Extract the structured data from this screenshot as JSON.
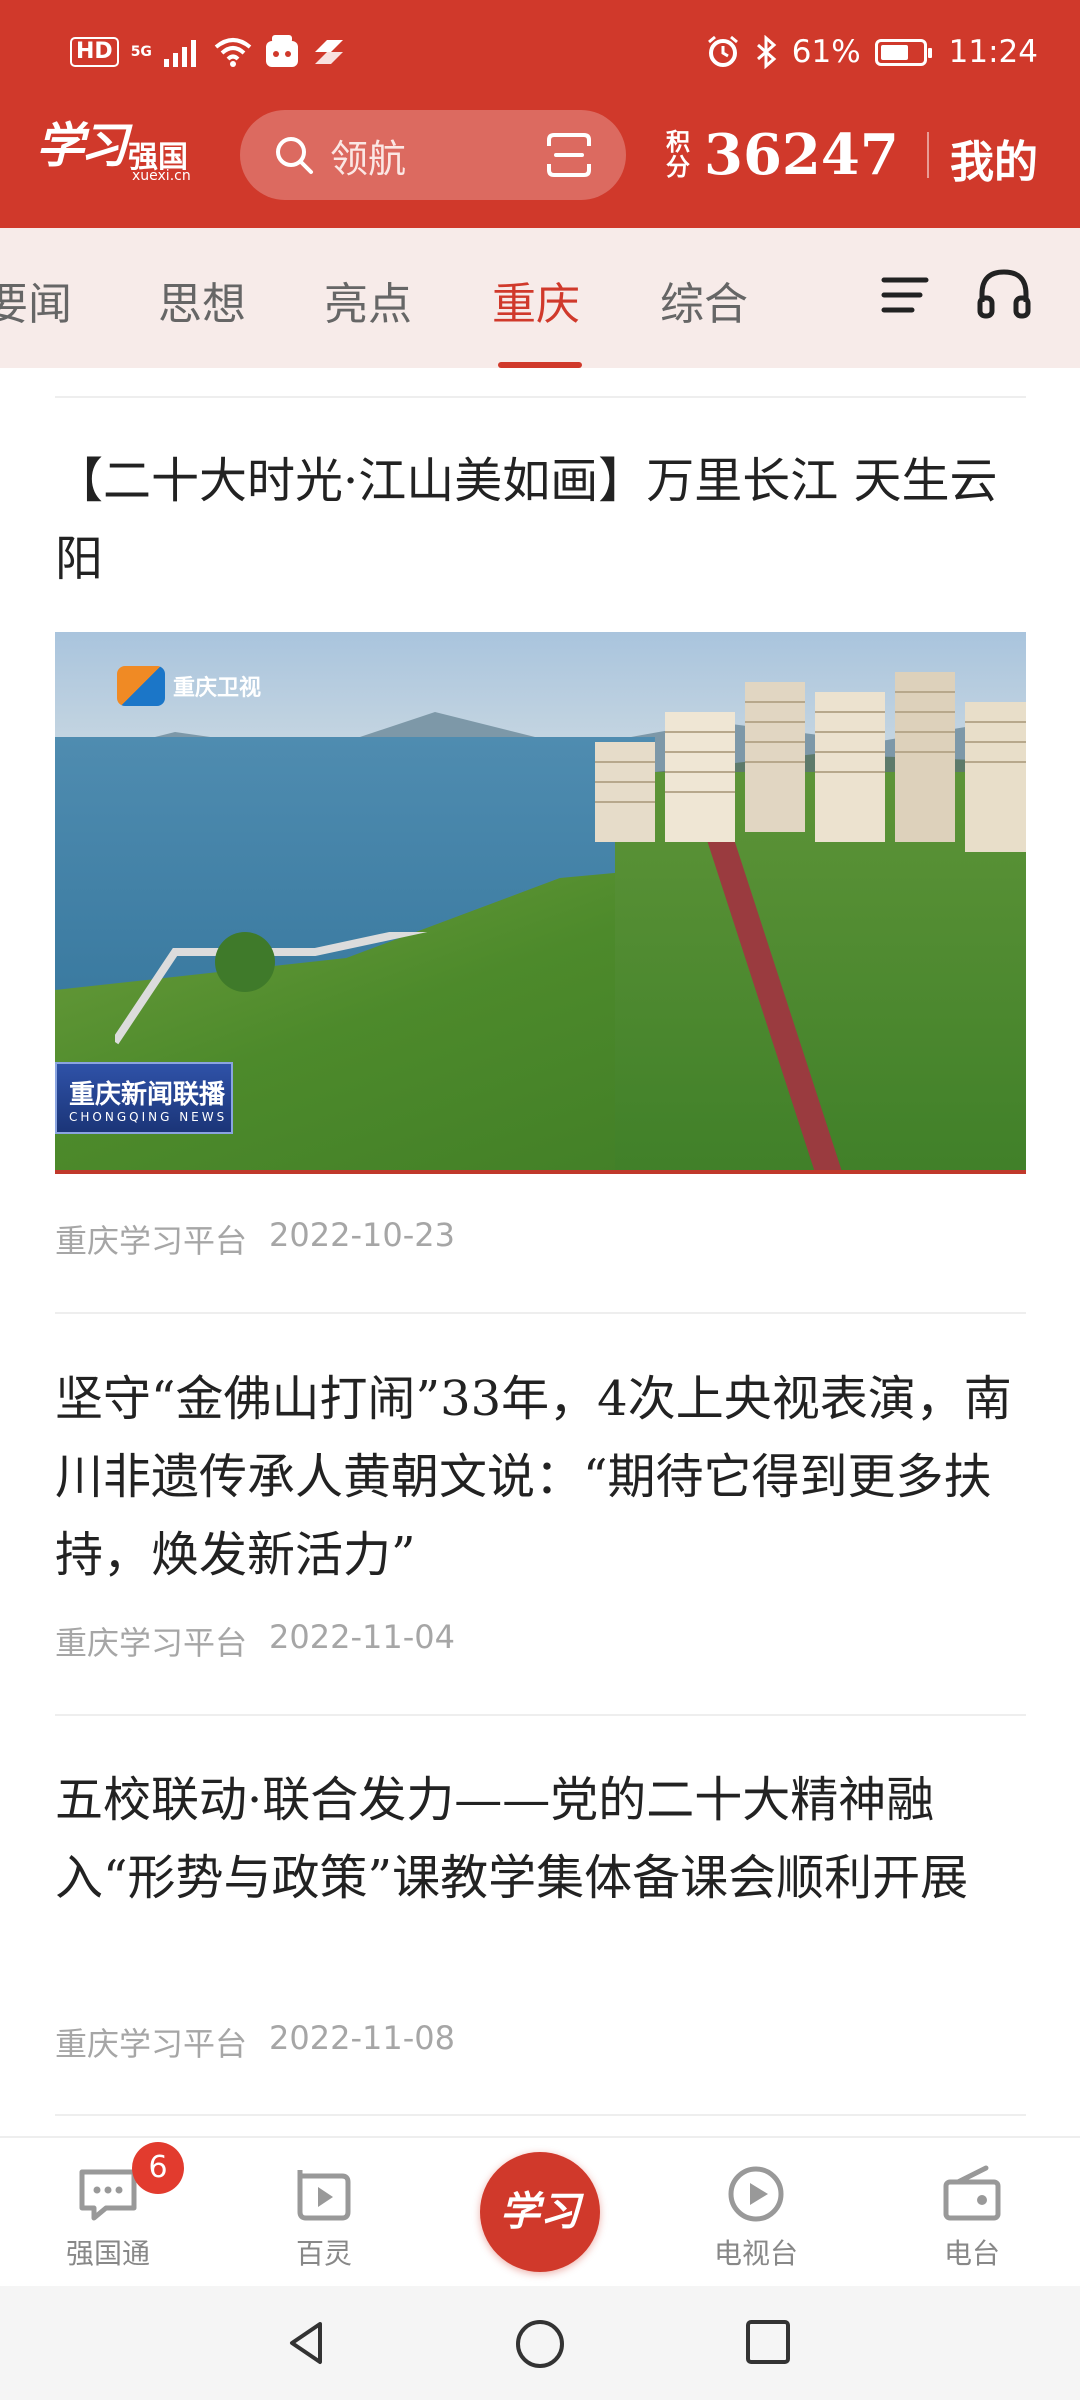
{
  "status_bar": {
    "hd": "HD",
    "network": "5G",
    "battery": "61%",
    "time": "11:24"
  },
  "header": {
    "logo_script": "学习",
    "logo_text": "强国",
    "logo_domain": "xuexi.cn",
    "search_placeholder": "领航",
    "points_label": "积分",
    "points_value": "36247",
    "my_label": "我的"
  },
  "tabs": [
    {
      "label": "要闻"
    },
    {
      "label": "思想"
    },
    {
      "label": "亮点"
    },
    {
      "label": "重庆",
      "active": true
    },
    {
      "label": "综合"
    }
  ],
  "feed": [
    {
      "title": "【二十大时光·江山美如画】万里长江 天生云阳",
      "has_video": true,
      "video_channel": "重庆卫视",
      "video_tag": "重庆新闻联播",
      "video_tag_en": "CHONGQING NEWS",
      "source": "重庆学习平台",
      "date": "2022-10-23"
    },
    {
      "title": "坚守“金佛山打闹”33年，4次上央视表演，南川非遗传承人黄朝文说：“期待它得到更多扶持，焕发新活力”",
      "source": "重庆学习平台",
      "date": "2022-11-04"
    },
    {
      "title": "五校联动·联合发力——党的二十大精神融入“形势与政策”课教学集体备课会顺利开展",
      "source": "重庆学习平台",
      "date": "2022-11-08"
    }
  ],
  "bottom_nav": {
    "items": [
      {
        "label": "强国通",
        "icon": "chat-icon"
      },
      {
        "label": "百灵",
        "icon": "play-square-icon"
      },
      {
        "label": "电视台",
        "icon": "play-circle-icon"
      },
      {
        "label": "电台",
        "icon": "radio-icon"
      }
    ],
    "badge": "6",
    "center_label": "学习"
  },
  "colors": {
    "brand": "#d0392b",
    "tab_bg": "#f7ebe9",
    "meta_text": "#a6a6a6"
  }
}
